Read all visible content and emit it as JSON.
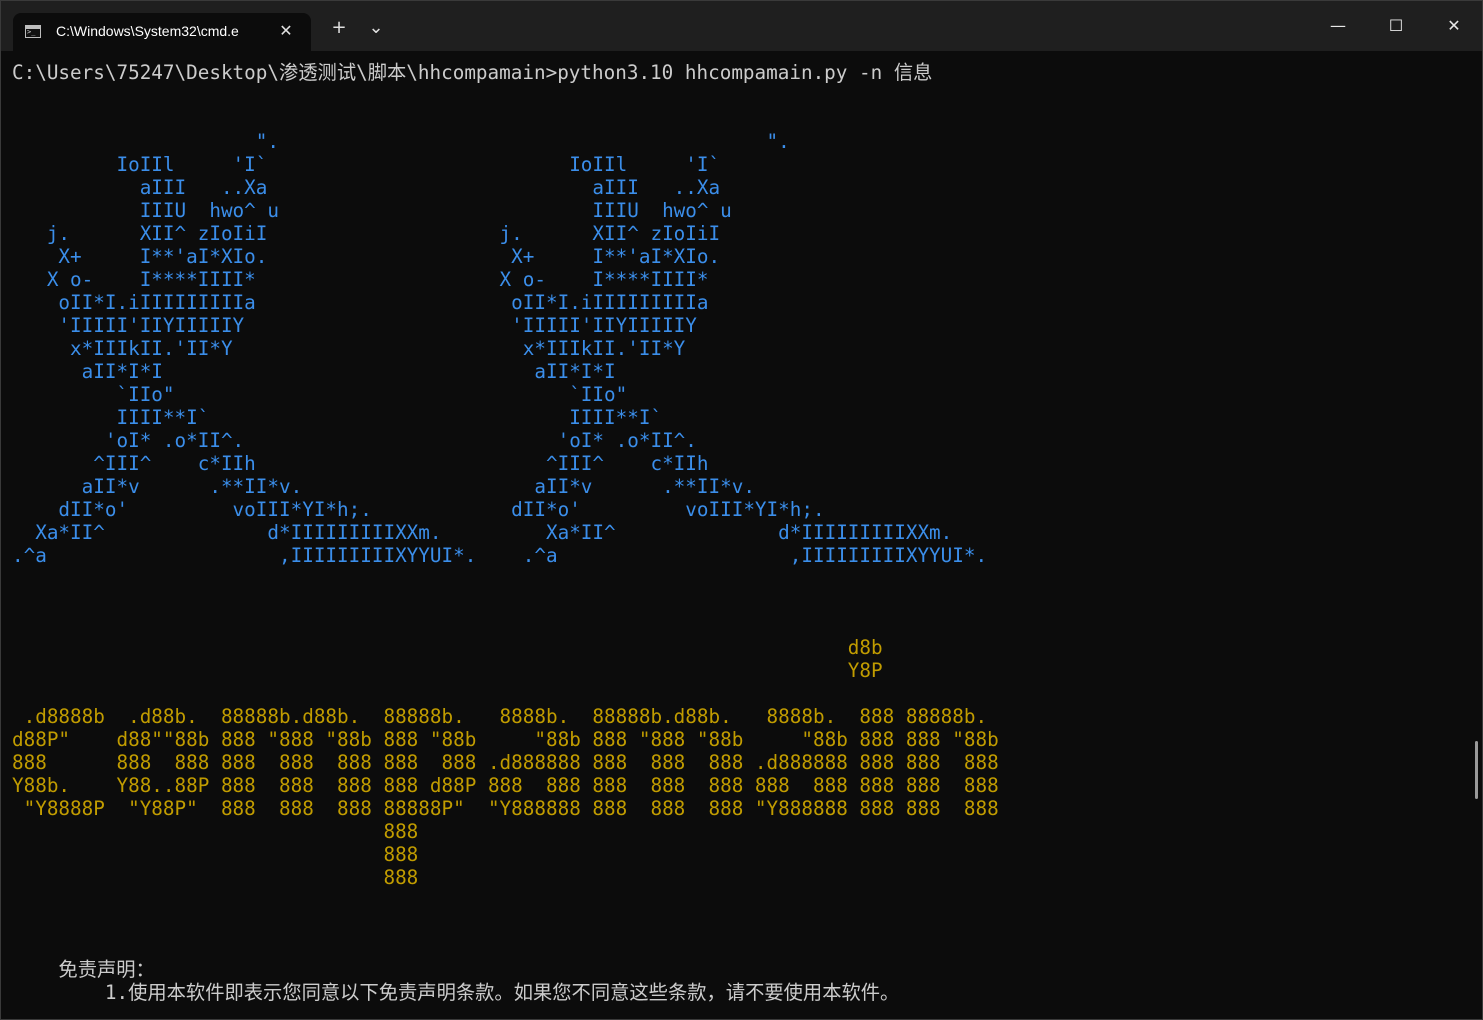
{
  "window": {
    "tab_title": "C:\\Windows\\System32\\cmd.e",
    "tab_close_glyph": "✕",
    "new_tab_glyph": "+",
    "dropdown_glyph": "⌄",
    "minimize_glyph": "—",
    "maximize_glyph": "☐",
    "close_glyph": "✕"
  },
  "terminal": {
    "prompt_line": "C:\\Users\\75247\\Desktop\\渗透测试\\脚本\\hhcompamain>python3.10 hhcompamain.py -n 信息",
    "art_blue": "\n\n                     \".                                          \".\n         IoIIl     'I`                          IoIIl     'I`\n           aIII   ..Xa                            aIII   ..Xa\n           IIIU  hwo^ u                           IIIU  hwo^ u\n   j.      XII^ zIoIiI                    j.      XII^ zIoIiI\n    X+     I**'aI*XIo.                     X+     I**'aI*XIo.\n   X o-    I****IIII*                     X o-    I****IIII*\n    oII*I.iIIIIIIIIIa                      oII*I.iIIIIIIIIIa\n    'IIIII'IIYIIIIIY                       'IIIII'IIYIIIIIY\n     x*IIIkII.'II*Y                         x*IIIkII.'II*Y\n      aII*I*I                                aII*I*I\n         `IIo\"                                  `IIo\"\n         IIII**I`                               IIII**I`\n        'oI* .o*II^.                           'oI* .o*II^.\n       ^III^    c*IIh                         ^III^    c*IIh\n      aII*v      .**II*v.                    aII*v      .**II*v.\n    dII*o'         voIII*YI*h;.            dII*o'         voIII*YI*h;.\n  Xa*II^              d*IIIIIIIIIXXm.         Xa*II^              d*IIIIIIIIIXXm.\n.^a                    ,IIIIIIIIIXYYUI*.    .^a                    ,IIIIIIIIIXYYUI*.",
    "art_yellow": "\n\n\n                                                                        d8b\n                                                                        Y8P\n\n .d8888b  .d88b.  88888b.d88b.  88888b.   8888b.  88888b.d88b.   8888b.  888 88888b.\nd88P\"    d88\"\"88b 888 \"888 \"88b 888 \"88b     \"88b 888 \"888 \"88b     \"88b 888 888 \"88b\n888      888  888 888  888  888 888  888 .d888888 888  888  888 .d888888 888 888  888\nY88b.    Y88..88P 888  888  888 888 d88P 888  888 888  888  888 888  888 888 888  888\n \"Y8888P  \"Y88P\"  888  888  888 88888P\"  \"Y888888 888  888  888 \"Y888888 888 888  888\n                                888\n                                888\n                                888",
    "disclaimer_title": "    免责声明：",
    "disclaimer_item_1": "        1.使用本软件即表示您同意以下免责声明条款。如果您不同意这些条款，请不要使用本软件。"
  }
}
